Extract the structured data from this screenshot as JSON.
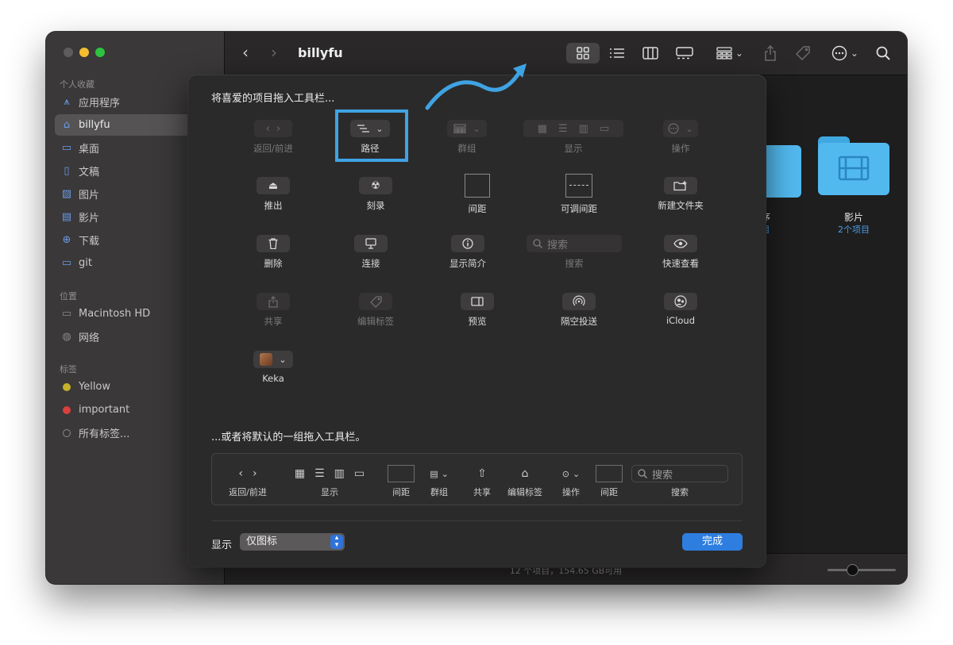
{
  "window": {
    "title": "billyfu",
    "status": "12 个项目，154.65 GB可用"
  },
  "sidebar": {
    "sections": [
      {
        "label": "个人收藏"
      },
      {
        "label": "位置"
      },
      {
        "label": "标签"
      }
    ],
    "favorites": [
      {
        "label": "应用程序",
        "icon": "apps-icon"
      },
      {
        "label": "billyfu",
        "icon": "home-icon",
        "active": true
      },
      {
        "label": "桌面",
        "icon": "desktop-icon"
      },
      {
        "label": "文稿",
        "icon": "document-icon"
      },
      {
        "label": "图片",
        "icon": "photo-icon"
      },
      {
        "label": "影片",
        "icon": "film-icon"
      },
      {
        "label": "下载",
        "icon": "download-icon"
      },
      {
        "label": "git",
        "icon": "folder-icon"
      }
    ],
    "locations": [
      {
        "label": "Macintosh HD",
        "icon": "disk-icon"
      },
      {
        "label": "网络",
        "icon": "network-icon"
      }
    ],
    "tags": [
      {
        "label": "Yellow",
        "color": "#c6b22a"
      },
      {
        "label": "important",
        "color": "#d9403d"
      },
      {
        "label": "所有标签...",
        "color": ""
      }
    ]
  },
  "folders": [
    {
      "label": "序",
      "sub": "目"
    },
    {
      "label": "影片",
      "sub": "2个项目"
    }
  ],
  "customize": {
    "heading": "将喜爱的项目拖入工具栏...",
    "items": [
      {
        "label": "返回/前进",
        "dim": true
      },
      {
        "label": "路径",
        "dim": false
      },
      {
        "label": "群组",
        "dim": true
      },
      {
        "label": "显示",
        "dim": true
      },
      {
        "label": "操作",
        "dim": true
      },
      {
        "label": "推出",
        "dim": false
      },
      {
        "label": "刻录",
        "dim": false
      },
      {
        "label": "间距",
        "dim": false
      },
      {
        "label": "可调间距",
        "dim": false
      },
      {
        "label": "新建文件夹",
        "dim": false
      },
      {
        "label": "删除",
        "dim": false
      },
      {
        "label": "连接",
        "dim": false
      },
      {
        "label": "显示简介",
        "dim": false
      },
      {
        "label": "搜索",
        "dim": true
      },
      {
        "label": "快速查看",
        "dim": false
      },
      {
        "label": "共享",
        "dim": true
      },
      {
        "label": "编辑标签",
        "dim": true
      },
      {
        "label": "预览",
        "dim": false
      },
      {
        "label": "隔空投送",
        "dim": false
      },
      {
        "label": "iCloud",
        "dim": false
      },
      {
        "label": "Keka",
        "dim": false
      }
    ],
    "search_placeholder": "搜索",
    "subheading": "...或者将默认的一组拖入工具栏。",
    "default_set": [
      {
        "label": "返回/前进"
      },
      {
        "label": "显示"
      },
      {
        "label": "间距"
      },
      {
        "label": "群组"
      },
      {
        "label": "共享"
      },
      {
        "label": "编辑标签"
      },
      {
        "label": "操作"
      },
      {
        "label": "间距"
      },
      {
        "label": "搜索"
      }
    ],
    "default_search_placeholder": "搜索",
    "show_label": "显示",
    "show_value": "仅图标",
    "done_label": "完成",
    "highlight_color": "#3fa3e3",
    "accent_color": "#2e7ee0"
  }
}
